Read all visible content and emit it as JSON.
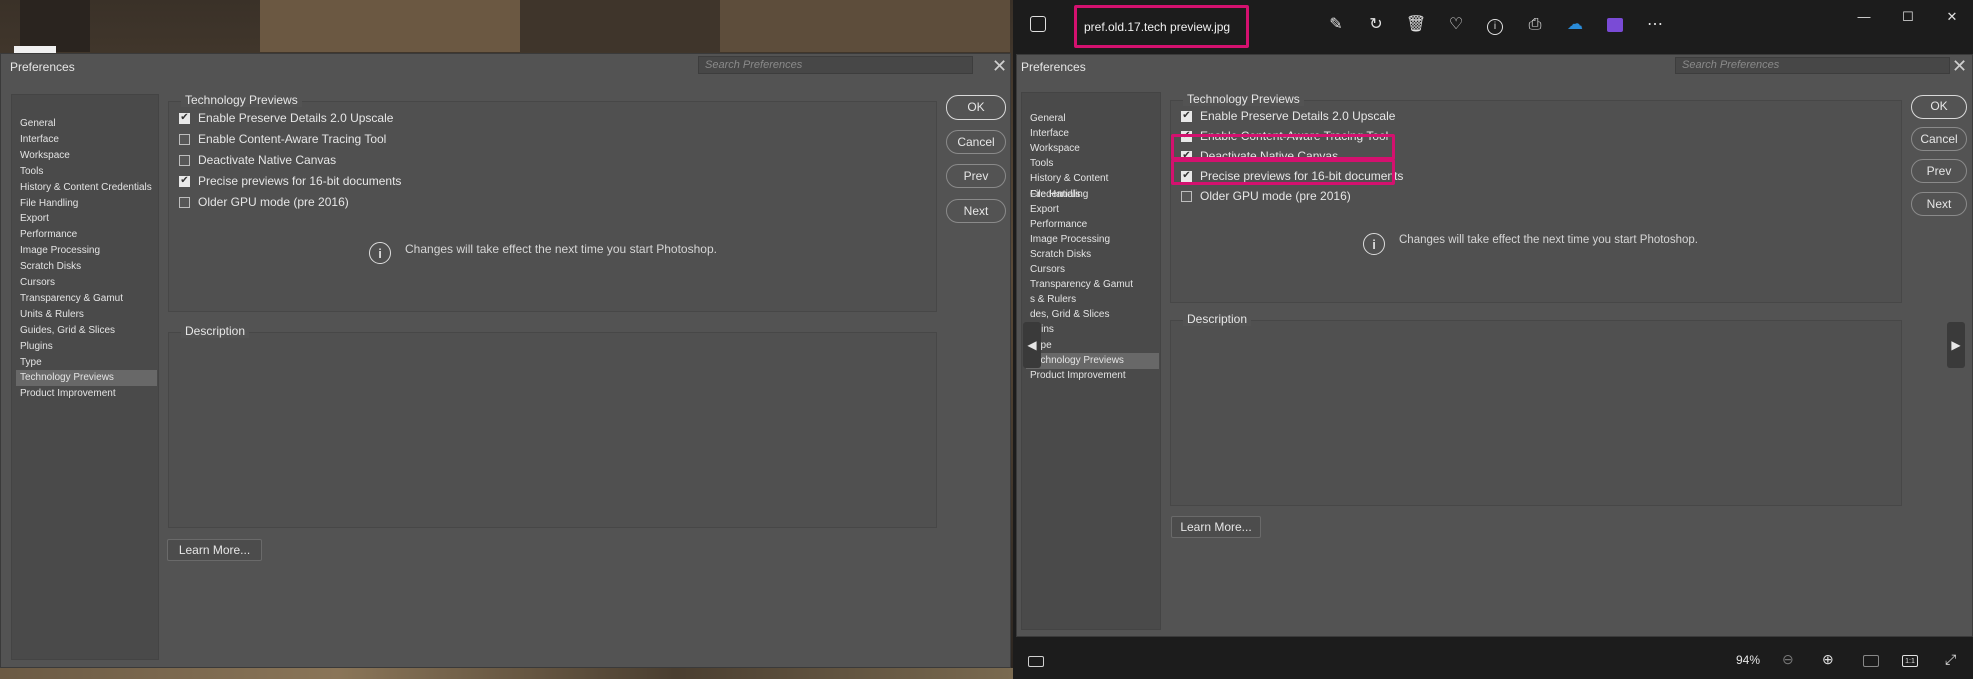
{
  "left_dialog": {
    "title": "Preferences",
    "search_placeholder": "Search Preferences",
    "sidebar": [
      "General",
      "Interface",
      "Workspace",
      "Tools",
      "History & Content Credentials",
      "File Handling",
      "Export",
      "Performance",
      "Image Processing",
      "Scratch Disks",
      "Cursors",
      "Transparency & Gamut",
      "Units & Rulers",
      "Guides, Grid & Slices",
      "Plugins",
      "Type",
      "Technology Previews",
      "Product Improvement"
    ],
    "active_index": 16,
    "group_title": "Technology Previews",
    "options": [
      {
        "label": "Enable Preserve Details 2.0 Upscale",
        "checked": true
      },
      {
        "label": "Enable Content-Aware Tracing Tool",
        "checked": false
      },
      {
        "label": "Deactivate Native Canvas",
        "checked": false
      },
      {
        "label": "Precise previews for 16-bit documents",
        "checked": true
      },
      {
        "label": "Older GPU mode (pre 2016)",
        "checked": false
      }
    ],
    "info_text": "Changes will take effect the next time you start Photoshop.",
    "description_title": "Description",
    "learn_more": "Learn More...",
    "buttons": {
      "ok": "OK",
      "cancel": "Cancel",
      "prev": "Prev",
      "next": "Next"
    }
  },
  "viewer": {
    "filename": "pref.old.17.tech preview.jpg",
    "zoom": "94%",
    "icons": [
      "edit-image-icon",
      "rotate-icon",
      "delete-icon",
      "favorite-icon",
      "info-icon",
      "print-icon",
      "onedrive-icon",
      "clipchamp-icon",
      "more-icon"
    ],
    "window_controls": {
      "minimize": "—",
      "maximize": "☐",
      "close": "✕"
    }
  },
  "right_dialog": {
    "title": "Preferences",
    "search_placeholder": "Search Preferences",
    "sidebar": [
      "General",
      "Interface",
      "Workspace",
      "Tools",
      "History & Content Credentials",
      "File Handling",
      "Export",
      "Performance",
      "Image Processing",
      "Scratch Disks",
      "Cursors",
      "Transparency & Gamut",
      "s & Rulers",
      "des, Grid & Slices",
      "ugins",
      "Type",
      "Technology Previews",
      "Product Improvement"
    ],
    "active_index": 16,
    "group_title": "Technology Previews",
    "options": [
      {
        "label": "Enable Preserve Details 2.0 Upscale",
        "checked": true
      },
      {
        "label": "Enable Content-Aware Tracing Tool",
        "checked": true
      },
      {
        "label": "Deactivate Native Canvas",
        "checked": true
      },
      {
        "label": "Precise previews for 16-bit documents",
        "checked": true
      },
      {
        "label": "Older GPU mode (pre 2016)",
        "checked": false
      }
    ],
    "info_text": "Changes will take effect the next time you start Photoshop.",
    "description_title": "Description",
    "learn_more": "Learn More...",
    "buttons": {
      "ok": "OK",
      "cancel": "Cancel",
      "prev": "Prev",
      "next": "Next"
    }
  },
  "colors": {
    "highlight": "#d4116f",
    "dialog_bg": "#535353",
    "viewer_bg": "#1c1c1c"
  }
}
